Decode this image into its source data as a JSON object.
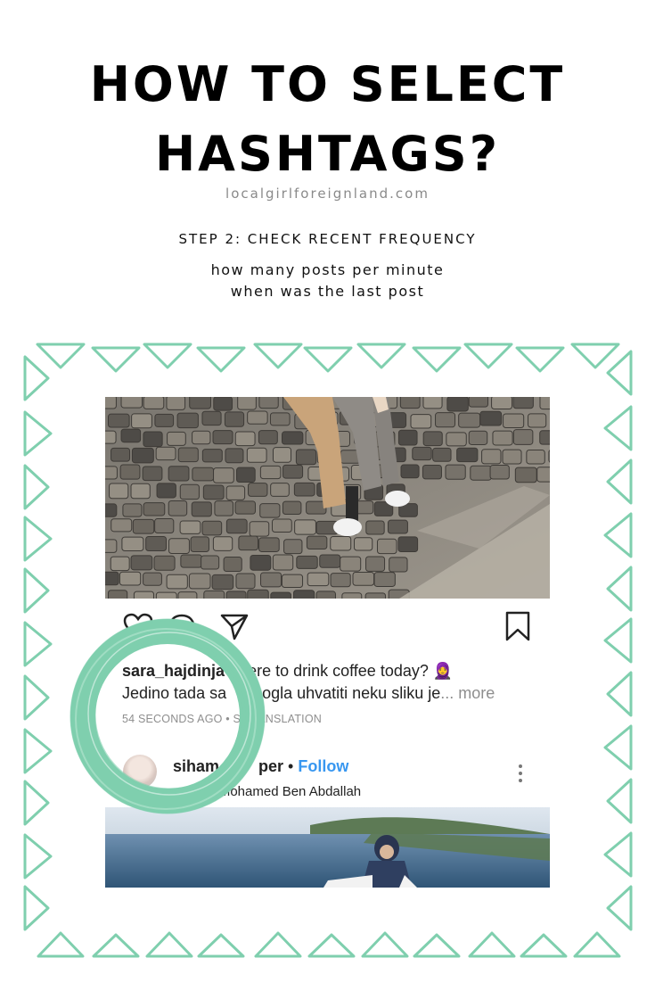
{
  "header": {
    "title_line1": "HOW TO SELECT",
    "title_line2": "HASHTAGS?",
    "site": "localgirlforeignland.com",
    "step": "STEP 2: CHECK RECENT FREQUENCY",
    "sub_line1": "how many posts per minute",
    "sub_line2": "when was the last post"
  },
  "post": {
    "username": "sara_hajdinja",
    "caption_rest": "ere to drink coffee today? 🧕",
    "caption_line2": "Jedino tada sa",
    "caption_line2b": "ogla uhvatiti neku sliku je",
    "more": "... more",
    "time": "54 SECONDS AGO",
    "translation_sep": " • S",
    "translation": "RANSLATION",
    "icons": [
      "heart-icon",
      "comment-icon",
      "share-icon",
      "bookmark-icon"
    ]
  },
  "next_post": {
    "username": "siham",
    "username_rest": "per",
    "follow": "Follow",
    "separator": " • ",
    "location": "di Mohamed Ben Abdallah"
  },
  "colors": {
    "accent": "#7fcfae",
    "follow": "#3897f0"
  }
}
